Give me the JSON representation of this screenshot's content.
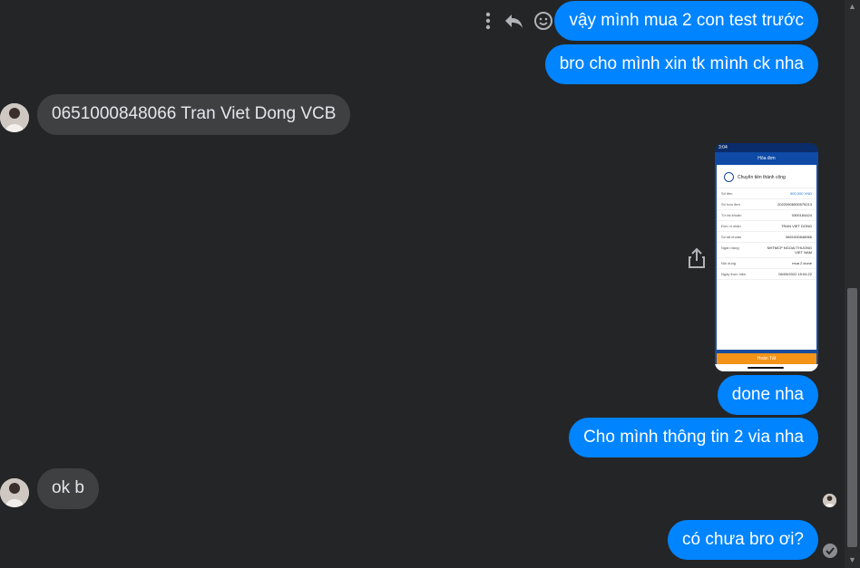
{
  "messages": {
    "m1": "vậy mình mua 2 con test trước",
    "m2": "bro cho mình xin tk mình ck nha",
    "m3": "0651000848066 Tran Viet Dong VCB",
    "m4": "done nha",
    "m5": "Cho mình thông tin 2 via nha",
    "m6": "ok b",
    "m7": "có chưa bro ơi?"
  },
  "receipt": {
    "status_time": "3:04",
    "bar_title": "Hóa đơn",
    "success_text": "Chuyển tiền thành công",
    "rows": [
      {
        "label": "Số tiền",
        "value": "500,000 VND"
      },
      {
        "label": "Số hóa đơn",
        "value": "20220906000576213"
      },
      {
        "label": "Từ tài khoản",
        "value": "0300184424"
      },
      {
        "label": "Đơn vị nhận",
        "value": "TRAN VIET DONG"
      },
      {
        "label": "Số tài khoản",
        "value": "0651000848066"
      },
      {
        "label": "Ngân hàng",
        "value": "NHTMCP NGOAI THUONG VIET NAM"
      },
      {
        "label": "Nội dung",
        "value": "mua 2 clone"
      },
      {
        "label": "Ngày thực hiện",
        "value": "06/09/2022 15:04:22"
      }
    ],
    "button_label": "Hoàn Tất"
  },
  "colors": {
    "outgoing": "#0084ff",
    "incoming": "#3e4042",
    "background": "#242526"
  }
}
